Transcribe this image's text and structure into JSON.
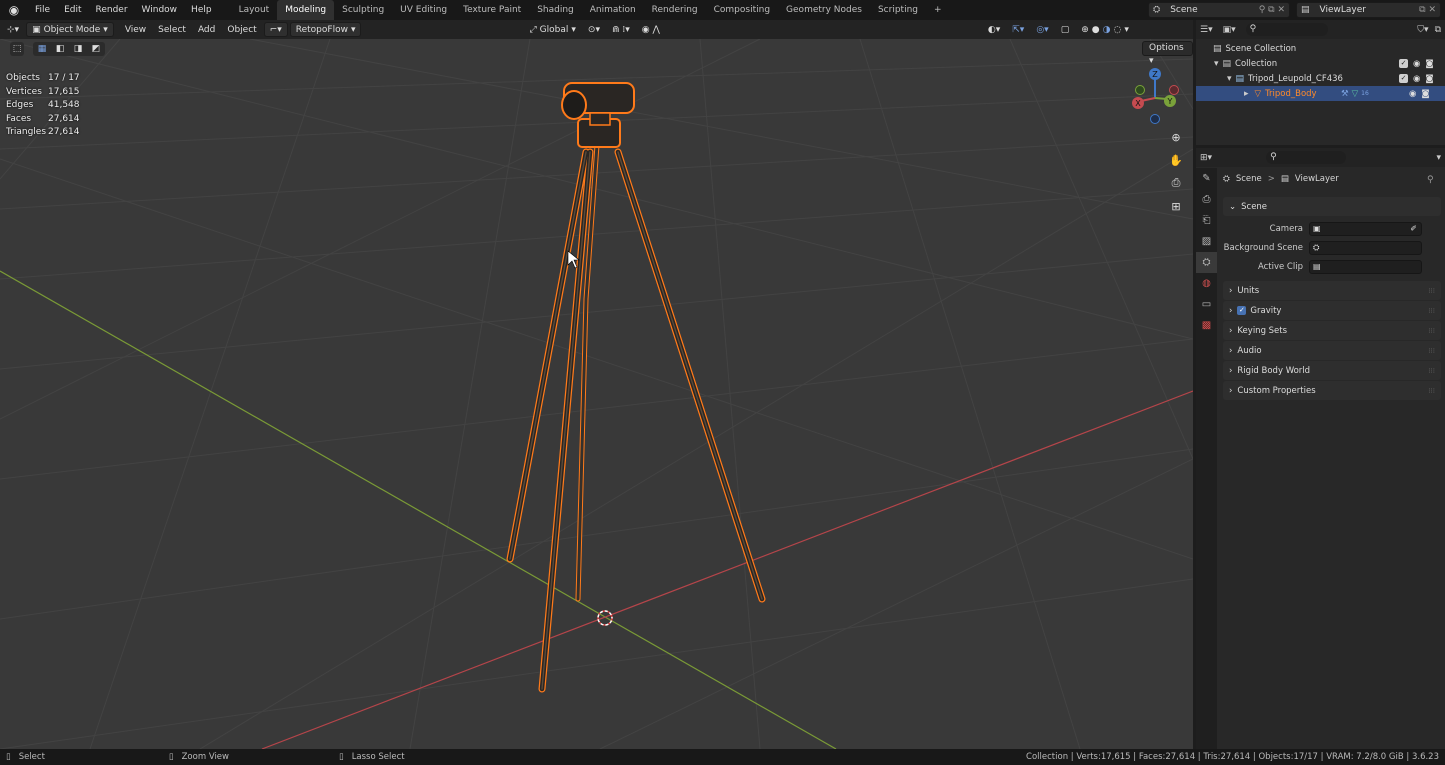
{
  "topbar": {
    "menus": [
      "File",
      "Edit",
      "Render",
      "Window",
      "Help"
    ],
    "workspaces": [
      "Layout",
      "Modeling",
      "Sculpting",
      "UV Editing",
      "Texture Paint",
      "Shading",
      "Animation",
      "Rendering",
      "Compositing",
      "Geometry Nodes",
      "Scripting"
    ],
    "active_workspace": "Modeling",
    "add_workspace": "+",
    "scene": "Scene",
    "view_layer": "ViewLayer"
  },
  "viewport_header": {
    "mode": "Object Mode",
    "menus": [
      "View",
      "Select",
      "Add",
      "Object"
    ],
    "addon": "RetopoFlow",
    "orientation": "Global",
    "options": "Options"
  },
  "stats": [
    {
      "k": "Objects",
      "v": "17 / 17"
    },
    {
      "k": "Vertices",
      "v": "17,615"
    },
    {
      "k": "Edges",
      "v": "41,548"
    },
    {
      "k": "Faces",
      "v": "27,614"
    },
    {
      "k": "Triangles",
      "v": "27,614"
    }
  ],
  "gizmo": {
    "x": "X",
    "y": "Y",
    "z": "Z"
  },
  "outliner": {
    "rows": [
      {
        "label": "Scene Collection"
      },
      {
        "label": "Collection"
      },
      {
        "label": "Tripod_Leupold_CF436"
      },
      {
        "label": "Tripod_Body"
      }
    ],
    "modifier_count": "16"
  },
  "properties": {
    "breadcrumb": {
      "scene": "Scene",
      "separator": ">",
      "view_layer": "ViewLayer"
    },
    "scene_panel": "Scene",
    "fields": [
      {
        "label": "Camera"
      },
      {
        "label": "Background Scene"
      },
      {
        "label": "Active Clip"
      }
    ],
    "panels": [
      "Units",
      "Gravity",
      "Keying Sets",
      "Audio",
      "Rigid Body World",
      "Custom Properties"
    ]
  },
  "statusbar": {
    "left": [
      "Select",
      "Zoom View",
      "Lasso Select"
    ],
    "right": "Collection | Verts:17,615 | Faces:27,614 | Tris:27,614 | Objects:17/17 | VRAM: 7.2/8.0 GiB | 3.6.23"
  },
  "colors": {
    "accent": "#4772b3",
    "selection": "#f07a1e",
    "x_axis": "#c44b50",
    "y_axis": "#7aa23a"
  }
}
